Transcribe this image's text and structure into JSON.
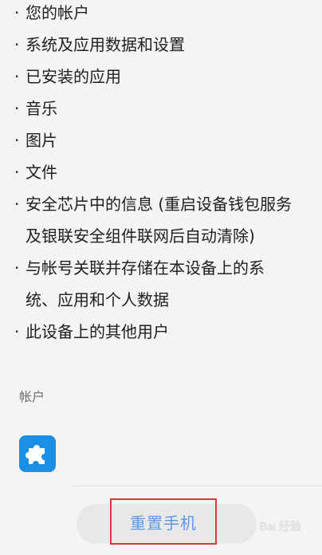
{
  "items": [
    {
      "text": "您的帐户"
    },
    {
      "text": "系统及应用数据和设置"
    },
    {
      "text": "已安装的应用"
    },
    {
      "text": "音乐"
    },
    {
      "text": "图片"
    },
    {
      "text": "文件"
    },
    {
      "lines": [
        "安全芯片中的信息 (重启设备钱包服务",
        "及银联安全组件联网后自动清除)"
      ]
    },
    {
      "lines": [
        "与帐号关联并存储在本设备上的系",
        "统、应用和个人数据"
      ]
    },
    {
      "text": "此设备上的其他用户"
    }
  ],
  "accounts_section": {
    "label": "帐户",
    "icon": "puzzle-piece-icon",
    "icon_color": "#1a8fe6"
  },
  "reset_button": {
    "label": "重置手机",
    "color": "#5f98e6",
    "highlight_color": "#d93a3a"
  },
  "watermark": {
    "text": "Bai  经验"
  }
}
